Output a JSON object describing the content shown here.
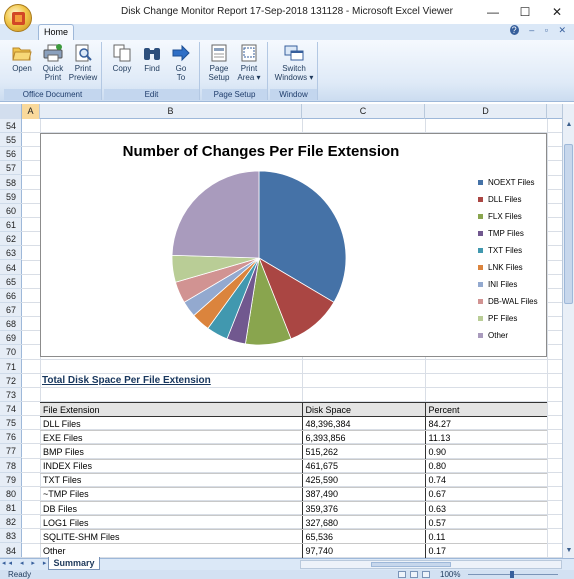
{
  "window": {
    "title": "Disk Change Monitor Report 17-Sep-2018 131128  -  Microsoft Excel Viewer",
    "minimize": "—",
    "maximize": "☐",
    "close": "✕"
  },
  "ribbon": {
    "tab": "Home",
    "help_icons": [
      "?",
      "–",
      "▫",
      "✕"
    ],
    "groups": [
      {
        "label": "Office Document",
        "buttons": [
          {
            "line1": "Open",
            "line2": "",
            "icon": "folder-icon"
          },
          {
            "line1": "Quick",
            "line2": "Print",
            "icon": "printer-icon"
          },
          {
            "line1": "Print",
            "line2": "Preview",
            "icon": "print-preview-icon"
          }
        ]
      },
      {
        "label": "Edit",
        "buttons": [
          {
            "line1": "Copy",
            "line2": "",
            "icon": "copy-icon"
          },
          {
            "line1": "Find",
            "line2": "",
            "icon": "binoculars-icon"
          },
          {
            "line1": "Go",
            "line2": "To",
            "icon": "arrow-right-icon"
          }
        ]
      },
      {
        "label": "Page Setup",
        "buttons": [
          {
            "line1": "Page",
            "line2": "Setup",
            "icon": "page-setup-icon"
          },
          {
            "line1": "Print",
            "line2": "Area ▾",
            "icon": "print-area-icon"
          }
        ]
      },
      {
        "label": "Window",
        "buttons": [
          {
            "line1": "Switch",
            "line2": "Windows ▾",
            "icon": "switch-windows-icon"
          }
        ]
      }
    ]
  },
  "sheet": {
    "columns": [
      "A",
      "B",
      "C",
      "D"
    ],
    "rows": [
      "54",
      "55",
      "56",
      "57",
      "58",
      "59",
      "60",
      "61",
      "62",
      "63",
      "64",
      "65",
      "66",
      "67",
      "68",
      "69",
      "70",
      "71",
      "72",
      "73",
      "74",
      "75",
      "76",
      "77",
      "78",
      "79",
      "80",
      "81",
      "82",
      "83",
      "84"
    ]
  },
  "chart_data": {
    "type": "pie",
    "title": "Number of Changes Per File Extension",
    "categories": [
      "NOEXT Files",
      "DLL Files",
      "FLX Files",
      "TMP Files",
      "TXT Files",
      "LNK Files",
      "INI Files",
      "DB-WAL Files",
      "PF Files",
      "Other"
    ],
    "values": [
      33.5,
      10.5,
      8.5,
      3.5,
      4.0,
      3.5,
      3.0,
      4.0,
      5.0,
      24.5
    ],
    "colors": [
      "#4572a7",
      "#aa4643",
      "#89a54e",
      "#71588f",
      "#4198af",
      "#db843d",
      "#93a9cf",
      "#d19392",
      "#b9cd96",
      "#a99bbd"
    ],
    "legend": "right"
  },
  "disk_table": {
    "title": "Total Disk Space Per File Extension",
    "headers": [
      "File Extension",
      "Disk Space",
      "Percent"
    ],
    "rows": [
      [
        "DLL Files",
        "48,396,384",
        "84.27"
      ],
      [
        "EXE Files",
        "6,393,856",
        "11.13"
      ],
      [
        "BMP Files",
        "515,262",
        "0.90"
      ],
      [
        "INDEX Files",
        "461,675",
        "0.80"
      ],
      [
        "TXT Files",
        "425,590",
        "0.74"
      ],
      [
        "~TMP Files",
        "387,490",
        "0.67"
      ],
      [
        "DB Files",
        "359,376",
        "0.63"
      ],
      [
        "LOG1 Files",
        "327,680",
        "0.57"
      ],
      [
        "SQLITE-SHM Files",
        "65,536",
        "0.11"
      ],
      [
        "Other",
        "97,740",
        "0.17"
      ]
    ]
  },
  "sheet_tab": "Summary",
  "sheet_nav": "◂◂ ◂ ▸ ▸▸",
  "status": {
    "ready": "Ready",
    "zoom": "100%",
    "zoom_minus": "–",
    "zoom_plus": "+"
  }
}
